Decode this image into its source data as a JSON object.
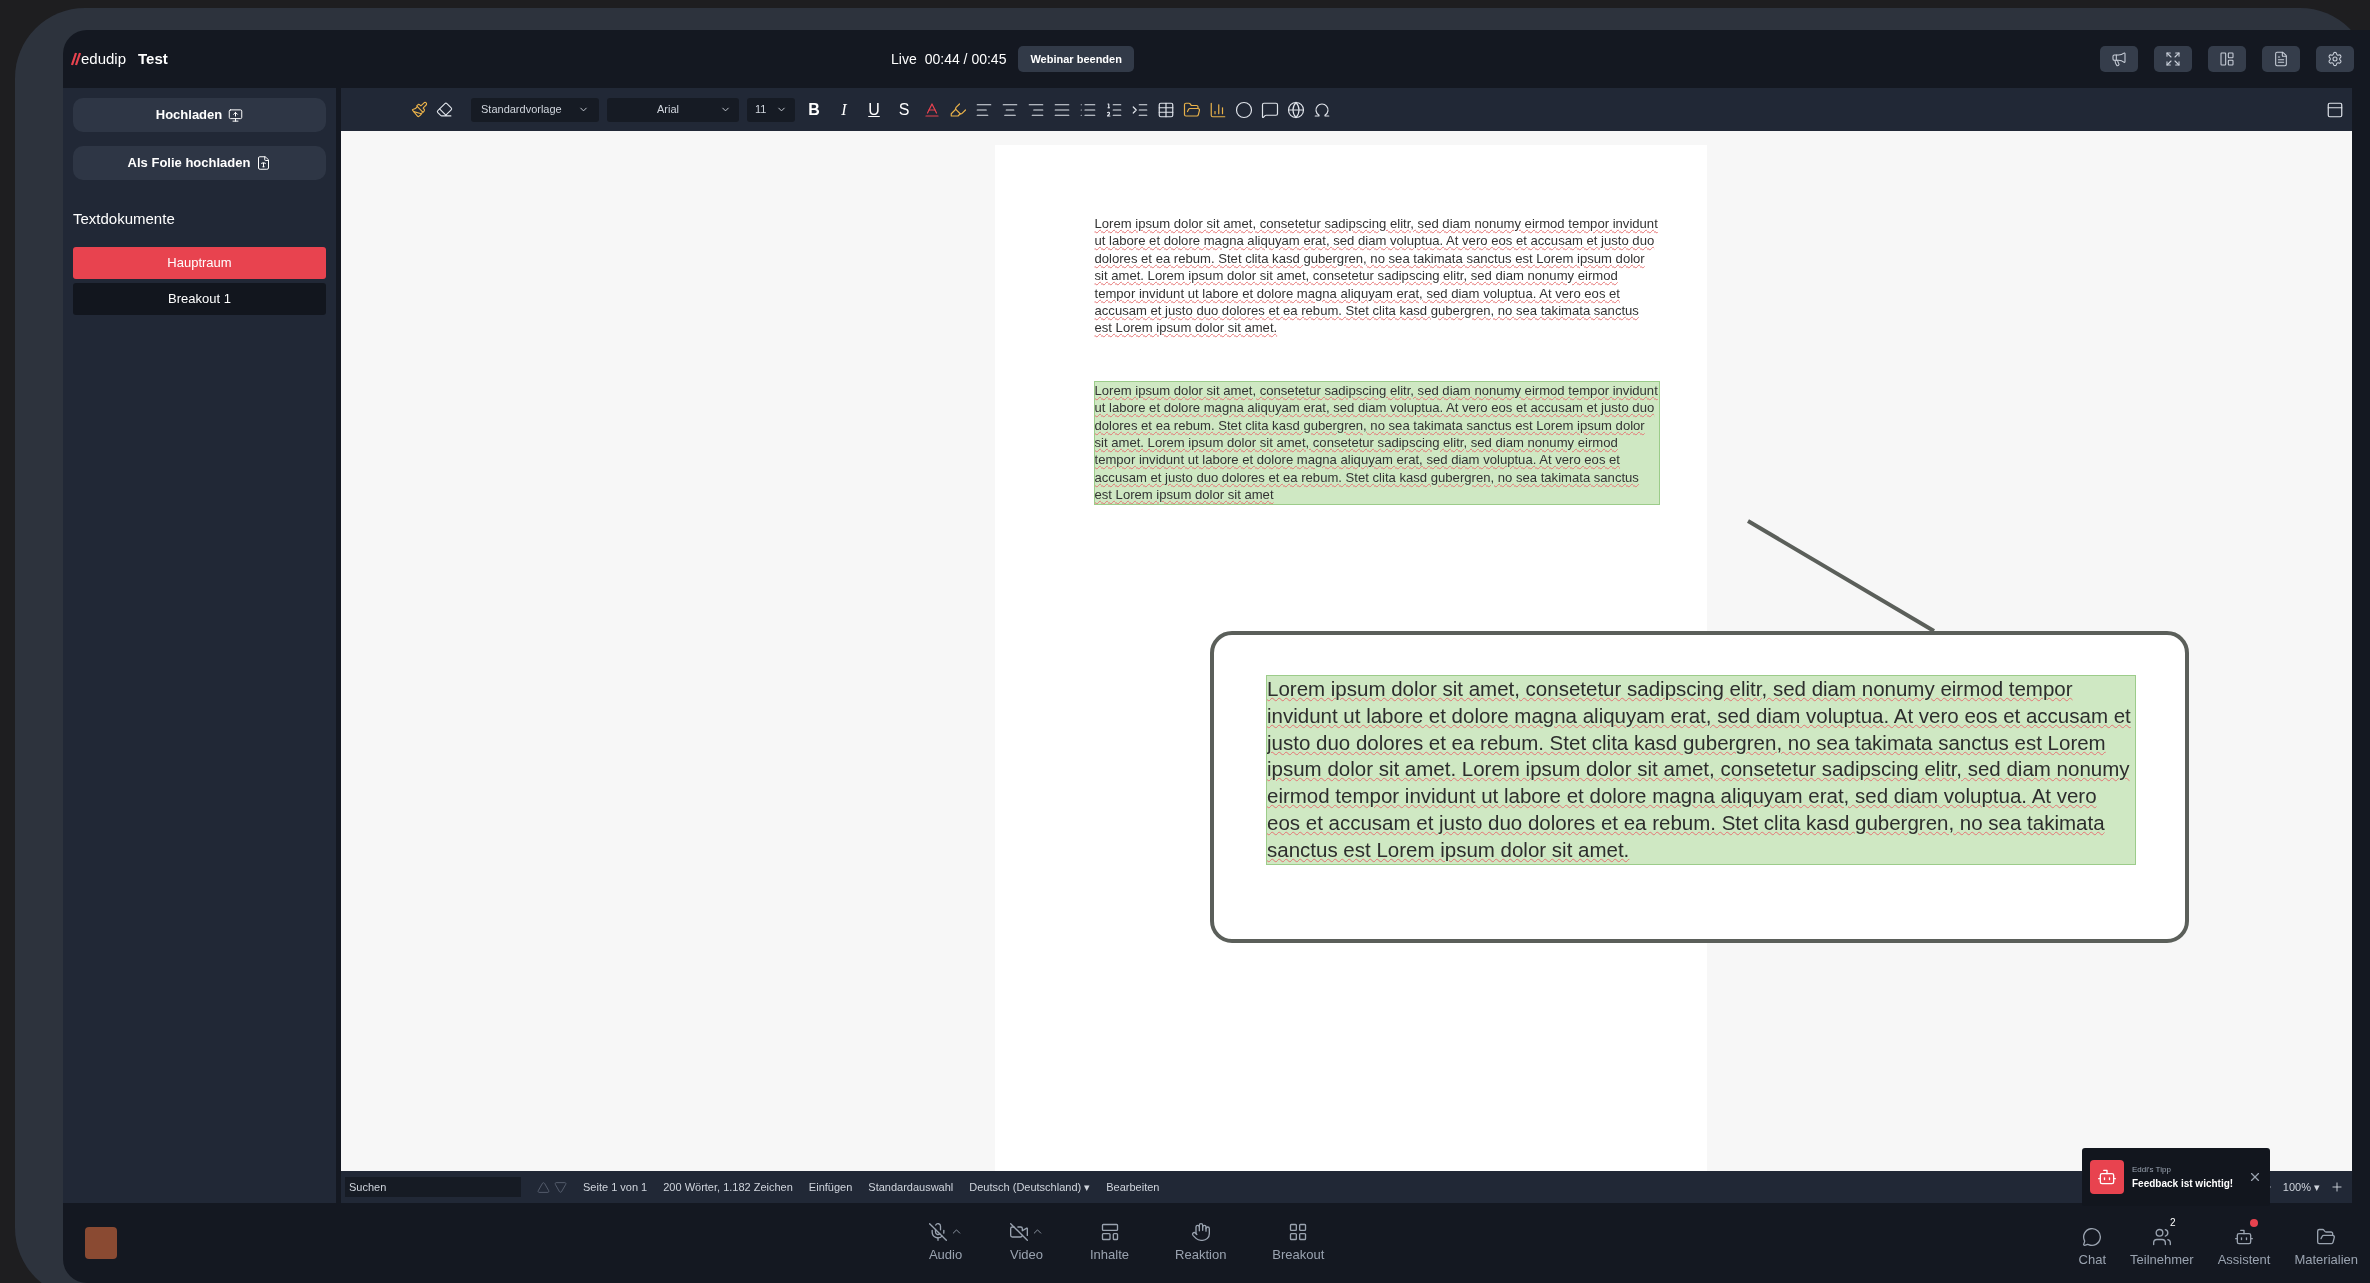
{
  "header": {
    "logo": "edudip",
    "title": "Test",
    "live_label": "Live",
    "timer": "00:44 / 00:45",
    "end_button": "Webinar beenden"
  },
  "sidebar": {
    "upload_buttons": [
      "Hochladen",
      "Als Folie hochladen"
    ],
    "section_title": "Textdokumente",
    "rooms": [
      {
        "label": "Hauptraum",
        "selected": true
      },
      {
        "label": "Breakout 1",
        "selected": false
      }
    ]
  },
  "toolbar": {
    "style": "Standardvorlage",
    "font": "Arial",
    "size": "11",
    "format_buttons": [
      "B",
      "I",
      "U",
      "S"
    ]
  },
  "document": {
    "paragraphs": [
      {
        "text": "Lorem ipsum dolor sit amet, consetetur sadipscing elitr, sed diam nonumy eirmod tempor invidunt ut labore et dolore magna aliquyam erat, sed diam voluptua. At vero eos et accusam et justo duo dolores et ea rebum. Stet clita kasd gubergren, no sea takimata sanctus est Lorem ipsum dolor sit amet. Lorem ipsum dolor sit amet, consetetur sadipscing elitr, sed diam nonumy eirmod tempor invidunt ut labore et dolore magna aliquyam erat, sed diam voluptua. At vero eos et accusam et justo duo dolores et ea rebum. Stet clita kasd gubergren, no sea takimata sanctus est Lorem ipsum dolor sit amet.",
        "selected": false
      },
      {
        "text": "Lorem ipsum dolor sit amet, consetetur sadipscing elitr, sed diam nonumy eirmod tempor invidunt ut labore et dolore magna aliquyam erat, sed diam voluptua. At vero eos et accusam et justo duo dolores et ea rebum. Stet clita kasd gubergren, no sea takimata sanctus est Lorem ipsum dolor sit amet. Lorem ipsum dolor sit amet, consetetur sadipscing elitr, sed diam nonumy eirmod tempor invidunt ut labore et dolore magna aliquyam erat, sed diam voluptua. At vero eos et accusam et justo duo dolores et ea rebum. Stet clita kasd gubergren, no sea takimata sanctus est Lorem ipsum dolor sit amet",
        "selected": true
      }
    ]
  },
  "callout": {
    "text": "Lorem ipsum dolor sit amet, consetetur sadipscing elitr, sed diam nonumy eirmod tempor invidunt ut labore et dolore magna aliquyam erat, sed diam voluptua. At vero eos et accusam et justo duo dolores et ea rebum. Stet clita kasd gubergren, no sea takimata sanctus est Lorem ipsum dolor sit amet. Lorem ipsum dolor sit amet, consetetur sadipscing elitr, sed diam nonumy eirmod tempor invidunt ut labore et dolore magna aliquyam erat, sed diam voluptua. At vero eos et accusam et justo duo dolores et ea rebum. Stet clita kasd gubergren, no sea takimata sanctus est Lorem ipsum dolor sit amet."
  },
  "status_bar": {
    "search": {
      "placeholder": "Suchen"
    },
    "items": [
      "Seite 1 von 1",
      "200 Wörter, 1.182 Zeichen",
      "Einfügen",
      "Standardauswahl",
      "Deutsch (Deutschland) ▾",
      "Bearbeiten"
    ],
    "zoom": "100% ▾"
  },
  "toast": {
    "label": "Eddi's Tipp",
    "message": "Feedback ist wichtig!"
  },
  "bottom_nav": {
    "center": [
      "Audio",
      "Video",
      "Inhalte",
      "Reaktion",
      "Breakout"
    ],
    "right": [
      {
        "label": "Chat"
      },
      {
        "label": "Teilnehmer",
        "badge": "2"
      },
      {
        "label": "Assistent",
        "dot": true
      },
      {
        "label": "Materialien"
      }
    ]
  }
}
